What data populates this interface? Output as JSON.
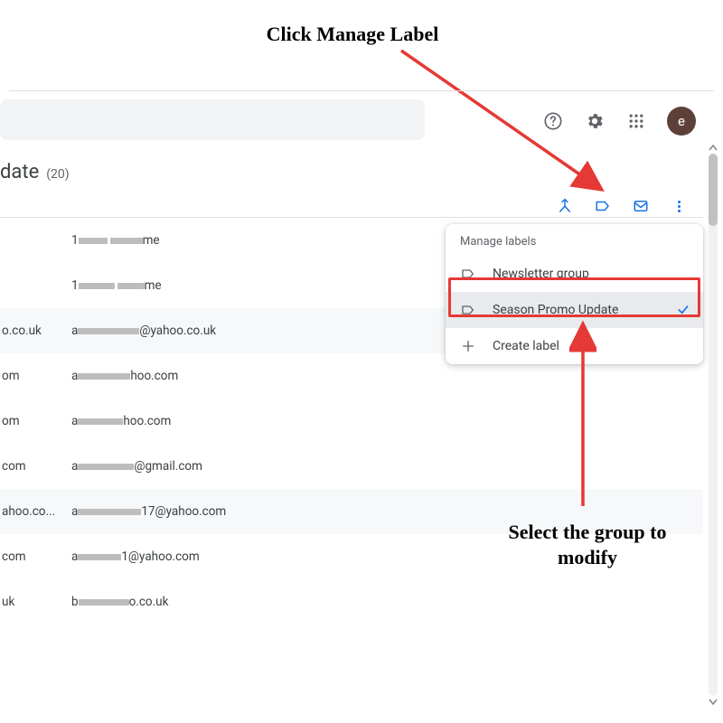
{
  "annotations": {
    "top": "Click Manage Label",
    "bottom": "Select the group to\nmodify"
  },
  "search": {
    "placeholder": ""
  },
  "title": {
    "text": "date",
    "count": "(20)"
  },
  "avatar": {
    "letter": "e"
  },
  "popup": {
    "title": "Manage labels",
    "items": [
      {
        "label": "Newsletter group"
      },
      {
        "label": "Season Promo Update"
      }
    ],
    "create": "Create label"
  },
  "rows": [
    {
      "domain": "",
      "pre": "1",
      "suf": "me",
      "r1": 32,
      "r2": 36
    },
    {
      "domain": "",
      "pre": "1",
      "suf": "me",
      "r1": 40,
      "r2": 30
    },
    {
      "domain": "o.co.uk",
      "pre": "a",
      "suf": "@yahoo.co.uk",
      "r1": 68,
      "r2": 0
    },
    {
      "domain": "om",
      "pre": "a",
      "suf": "hoo.com",
      "r1": 58,
      "r2": 0
    },
    {
      "domain": "om",
      "pre": "a",
      "suf": "hoo.com",
      "r1": 50,
      "r2": 0
    },
    {
      "domain": "com",
      "pre": "a",
      "suf": "@gmail.com",
      "r1": 62,
      "r2": 0
    },
    {
      "domain": "ahoo.co...",
      "pre": "a",
      "suf": "17@yahoo.com",
      "r1": 70,
      "r2": 0
    },
    {
      "domain": "com",
      "pre": "a",
      "suf": "1@yahoo.com",
      "r1": 48,
      "r2": 0
    },
    {
      "domain": "uk",
      "pre": "b",
      "suf": "o.co.uk",
      "r1": 56,
      "r2": 0
    }
  ]
}
